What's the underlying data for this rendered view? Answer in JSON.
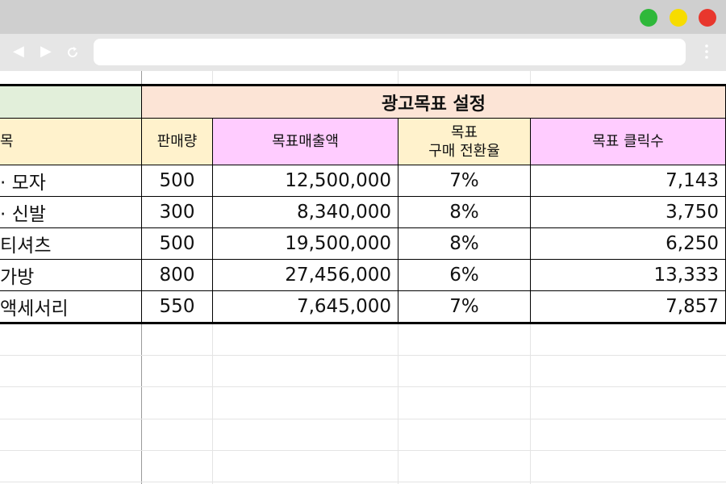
{
  "colors": {
    "green_header": "#e2efda",
    "salmon_header": "#fce4d6",
    "yellow_header": "#fff2cc",
    "pink_header": "#ffccff"
  },
  "browser": {
    "address": "",
    "back_icon": "◀",
    "forward_icon": "▶",
    "reload_icon": "↻",
    "menu_icon": "⋮"
  },
  "sheet": {
    "group_title": "광고목표 설정",
    "columns": {
      "item": "목",
      "sales_qty": "판매량",
      "target_revenue": "목표매출액",
      "conversion_line1": "목표",
      "conversion_line2": "구매 전환율",
      "target_clicks": "목표 클릭수"
    },
    "rows": [
      {
        "item": "· 모자",
        "qty": "500",
        "revenue": "12,500,000",
        "rate": "7%",
        "clicks": "7,143"
      },
      {
        "item": "· 신발",
        "qty": "300",
        "revenue": "8,340,000",
        "rate": "8%",
        "clicks": "3,750"
      },
      {
        "item": "티셔츠",
        "qty": "500",
        "revenue": "19,500,000",
        "rate": "8%",
        "clicks": "6,250"
      },
      {
        "item": "가방",
        "qty": "800",
        "revenue": "27,456,000",
        "rate": "6%",
        "clicks": "13,333"
      },
      {
        "item": "액세서리",
        "qty": "550",
        "revenue": "7,645,000",
        "rate": "7%",
        "clicks": "7,857"
      }
    ]
  }
}
